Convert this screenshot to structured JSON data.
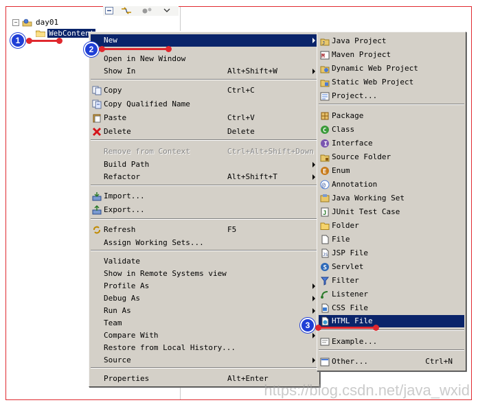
{
  "tree": {
    "project": "day01",
    "folder": "WebContent"
  },
  "context_menu": {
    "items": [
      {
        "label": "New",
        "submenu": true,
        "highlighted": true
      },
      {
        "label": "Open in New Window"
      },
      {
        "label": "Show In",
        "shortcut": "Alt+Shift+W",
        "submenu": true
      },
      {
        "label": "Copy",
        "shortcut": "Ctrl+C",
        "icon": "copy-icon"
      },
      {
        "label": "Copy Qualified Name",
        "icon": "copy-qualified-name-icon"
      },
      {
        "label": "Paste",
        "shortcut": "Ctrl+V",
        "icon": "paste-icon"
      },
      {
        "label": "Delete",
        "shortcut": "Delete",
        "icon": "delete-icon"
      },
      {
        "label": "Remove from Context",
        "shortcut": "Ctrl+Alt+Shift+Down",
        "disabled": true
      },
      {
        "label": "Build Path",
        "submenu": true
      },
      {
        "label": "Refactor",
        "shortcut": "Alt+Shift+T",
        "submenu": true
      },
      {
        "label": "Import...",
        "icon": "import-icon"
      },
      {
        "label": "Export...",
        "icon": "export-icon"
      },
      {
        "label": "Refresh",
        "shortcut": "F5",
        "icon": "refresh-icon"
      },
      {
        "label": "Assign Working Sets..."
      },
      {
        "label": "Validate"
      },
      {
        "label": "Show in Remote Systems view"
      },
      {
        "label": "Profile As",
        "submenu": true
      },
      {
        "label": "Debug As",
        "submenu": true
      },
      {
        "label": "Run As",
        "submenu": true
      },
      {
        "label": "Team",
        "submenu": true
      },
      {
        "label": "Compare With",
        "submenu": true
      },
      {
        "label": "Restore from Local History..."
      },
      {
        "label": "Source",
        "submenu": true
      },
      {
        "label": "Properties",
        "shortcut": "Alt+Enter"
      }
    ]
  },
  "new_submenu": {
    "items": [
      {
        "label": "Java Project",
        "icon": "java-project-icon"
      },
      {
        "label": "Maven Project",
        "icon": "maven-project-icon"
      },
      {
        "label": "Dynamic Web Project",
        "icon": "dynamic-web-project-icon"
      },
      {
        "label": "Static Web Project",
        "icon": "static-web-project-icon"
      },
      {
        "label": "Project...",
        "icon": "project-icon"
      },
      {
        "label": "Package",
        "icon": "package-icon"
      },
      {
        "label": "Class",
        "icon": "class-icon"
      },
      {
        "label": "Interface",
        "icon": "interface-icon"
      },
      {
        "label": "Source Folder",
        "icon": "source-folder-icon"
      },
      {
        "label": "Enum",
        "icon": "enum-icon"
      },
      {
        "label": "Annotation",
        "icon": "annotation-icon"
      },
      {
        "label": "Java Working Set",
        "icon": "java-working-set-icon"
      },
      {
        "label": "JUnit Test Case",
        "icon": "junit-test-case-icon"
      },
      {
        "label": "Folder",
        "icon": "folder-icon"
      },
      {
        "label": "File",
        "icon": "file-icon"
      },
      {
        "label": "JSP File",
        "icon": "jsp-file-icon"
      },
      {
        "label": "Servlet",
        "icon": "servlet-icon"
      },
      {
        "label": "Filter",
        "icon": "filter-icon"
      },
      {
        "label": "Listener",
        "icon": "listener-icon"
      },
      {
        "label": "CSS File",
        "icon": "css-file-icon"
      },
      {
        "label": "HTML File",
        "icon": "html-file-icon",
        "highlighted": true
      },
      {
        "label": "Example...",
        "icon": "example-icon"
      },
      {
        "label": "Other...",
        "shortcut": "Ctrl+N",
        "icon": "other-icon"
      }
    ]
  },
  "annotations": {
    "step1": "1",
    "step2": "2",
    "step3": "3"
  },
  "watermark": "https://blog.csdn.net/java_wxid",
  "colors": {
    "highlight": "#0a246a",
    "menu_bg": "#d4d0c8",
    "annotation_red": "#e0282e",
    "badge_blue": "#1f3fd6"
  }
}
